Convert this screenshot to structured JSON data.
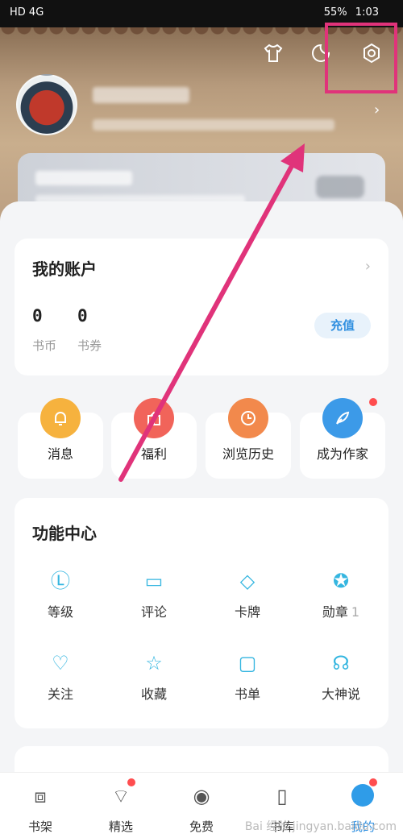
{
  "status_bar": {
    "left": "HD 4G",
    "battery": "55%",
    "time": "1:03"
  },
  "header": {
    "chevron": "›"
  },
  "account": {
    "title": "我的账户",
    "arrow": "›",
    "coins": {
      "value": "0",
      "label": "书币"
    },
    "vouchers": {
      "value": "0",
      "label": "书券"
    },
    "recharge": "充值"
  },
  "quick": [
    {
      "label": "消息",
      "icon": "bell-icon",
      "color": "#f6b23e"
    },
    {
      "label": "福利",
      "icon": "gift-icon",
      "color": "#f1645a"
    },
    {
      "label": "浏览历史",
      "icon": "clock-icon",
      "color": "#f2894c"
    },
    {
      "label": "成为作家",
      "icon": "feather-icon",
      "color": "#3c9ae8"
    }
  ],
  "functions": {
    "title": "功能中心",
    "items": [
      {
        "label": "等级",
        "icon": "level-icon",
        "glyph": "Ⓛ"
      },
      {
        "label": "评论",
        "icon": "comment-icon",
        "glyph": "▭"
      },
      {
        "label": "卡牌",
        "icon": "card-icon",
        "glyph": "◇"
      },
      {
        "label": "勋章",
        "icon": "medal-icon",
        "glyph": "✪",
        "count": "1"
      },
      {
        "label": "关注",
        "icon": "heart-icon",
        "glyph": "♡"
      },
      {
        "label": "收藏",
        "icon": "star-icon",
        "glyph": "☆"
      },
      {
        "label": "书单",
        "icon": "booklist-icon",
        "glyph": "▢"
      },
      {
        "label": "大神说",
        "icon": "speech-icon",
        "glyph": "☊"
      }
    ]
  },
  "tabs": [
    {
      "label": "书架",
      "icon": "bookshelf-icon",
      "glyph": "⧈"
    },
    {
      "label": "精选",
      "icon": "picks-icon",
      "glyph": "⌔"
    },
    {
      "label": "免费",
      "icon": "free-icon",
      "glyph": "◉"
    },
    {
      "label": "书库",
      "icon": "library-icon",
      "glyph": "▯"
    },
    {
      "label": "我的",
      "icon": "me-icon",
      "glyph": ""
    }
  ],
  "watermark": "Bai 经验 jingyan.baidu.com",
  "colors": {
    "accent": "#2f8fe0",
    "highlight": "#e0337a",
    "badge": "#ff4d4f"
  }
}
